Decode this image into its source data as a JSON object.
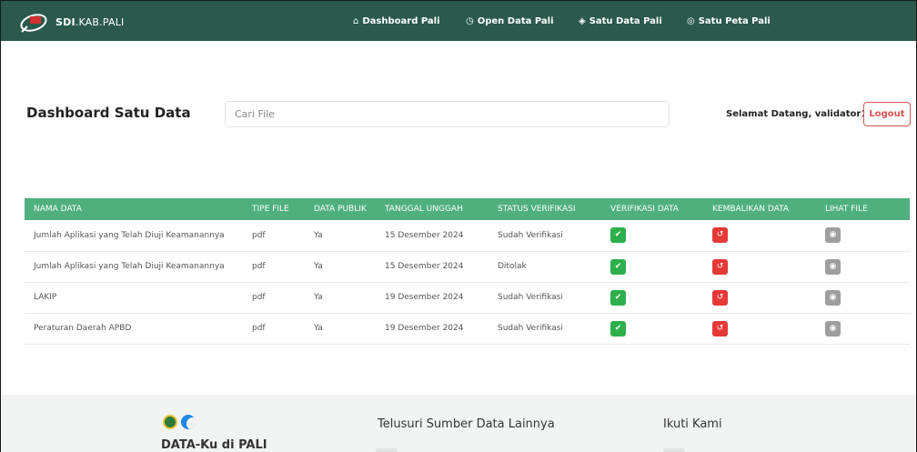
{
  "brand": {
    "text_bold": "SDI",
    "text_rest": ".KAB.PALI"
  },
  "nav": [
    {
      "icon": "home-icon",
      "glyph": "⌂",
      "label": "Dashboard Pali"
    },
    {
      "icon": "clock-icon",
      "glyph": "◷",
      "label": "Open Data Pali"
    },
    {
      "icon": "layers-icon",
      "glyph": "◈",
      "label": "Satu Data Pali"
    },
    {
      "icon": "globe-icon",
      "glyph": "◎",
      "label": "Satu Peta Pali"
    }
  ],
  "header": {
    "title": "Dashboard Satu Data",
    "search_placeholder": "Cari File",
    "welcome": "Selamat Datang, validator1",
    "logout": "Logout"
  },
  "table": {
    "columns": [
      "NAMA DATA",
      "TIPE FILE",
      "DATA PUBLIK",
      "TANGGAL UNGGAH",
      "STATUS VERIFIKASI",
      "VERIFIKASI DATA",
      "KEMBALIKAN DATA",
      "LIHAT FILE"
    ],
    "rows": [
      {
        "nama": "Jumlah Aplikasi yang Telah Diuji Keamanannya",
        "tipe": "pdf",
        "publik": "Ya",
        "tanggal": "15 Desember 2024",
        "status": "Sudah Verifikasi"
      },
      {
        "nama": "Jumlah Aplikasi yang Telah Diuji Keamanannya",
        "tipe": "pdf",
        "publik": "Ya",
        "tanggal": "15 Desember 2024",
        "status": "Ditolak"
      },
      {
        "nama": "LAKIP",
        "tipe": "pdf",
        "publik": "Ya",
        "tanggal": "19 Desember 2024",
        "status": "Sudah Verifikasi"
      },
      {
        "nama": "Peraturan Daerah APBD",
        "tipe": "pdf",
        "publik": "Ya",
        "tanggal": "19 Desember 2024",
        "status": "Sudah Verifikasi"
      }
    ],
    "action_icons": {
      "verify": "check-icon",
      "return": "undo-icon",
      "view": "eye-icon"
    }
  },
  "footer": {
    "brand": "DATA-Ku di PALI",
    "explore_heading": "Telusuri Sumber Data Lainnya",
    "follow_heading": "Ikuti Kami"
  },
  "colors": {
    "nav_bg": "#2b5a4d",
    "table_header": "#4fb07d",
    "verify": "#2db04b",
    "return": "#e53935",
    "view": "#9e9e9e",
    "logout": "#d9534f"
  }
}
